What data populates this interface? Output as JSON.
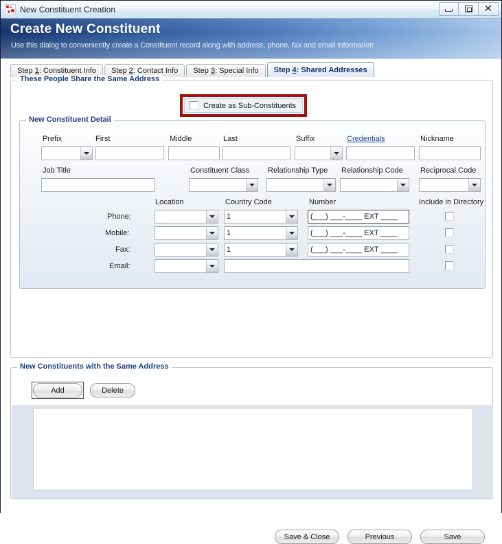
{
  "window": {
    "title": "New Constituent Creation",
    "icon": "constituent-icon",
    "controls": {
      "minimize": "minimize-icon",
      "restore": "restore-icon",
      "close": "close-icon",
      "close_glyph": "✕"
    }
  },
  "banner": {
    "title": "Create New Constituent",
    "subtitle": "Use this dialog to conveniently create a Constituent record along with address, phone, fax and email information"
  },
  "tabs": [
    {
      "prefix": "Step ",
      "key": "1",
      "suffix": ": Constituent Info",
      "active": false
    },
    {
      "prefix": "Step ",
      "key": "2",
      "suffix": ": Contact Info",
      "active": false
    },
    {
      "prefix": "Step ",
      "key": "3",
      "suffix": ": Special Info",
      "active": false
    },
    {
      "prefix": "Step ",
      "key": "4",
      "suffix": ": Shared Addresses",
      "active": true
    }
  ],
  "shared_address_group": {
    "legend": "These People Share the Same Address",
    "sub_constituents": {
      "label": "Create as Sub-Constituents",
      "checked": false,
      "highlight_color": "#a40f0f"
    }
  },
  "detail_group": {
    "legend": "New Constituent Detail",
    "name_row": {
      "prefix_label": "Prefix",
      "prefix_value": "",
      "first_label": "First",
      "first_value": "",
      "middle_label": "Middle",
      "middle_value": "",
      "last_label": "Last",
      "last_value": "",
      "suffix_label": "Suffix",
      "suffix_value": "",
      "credentials_label": "Credentials",
      "credentials_value": "",
      "nickname_label": "Nickname",
      "nickname_value": ""
    },
    "job_row": {
      "job_title_label": "Job Title",
      "job_title_value": "",
      "constituent_class_label": "Constituent Class",
      "constituent_class_value": "",
      "relationship_type_label": "Relationship Type",
      "relationship_type_value": "",
      "relationship_code_label": "Relationship Code",
      "relationship_code_value": "",
      "reciprocal_code_label": "Reciprocal Code",
      "reciprocal_code_value": ""
    },
    "contact_headers": {
      "location": "Location",
      "country_code": "Country Code",
      "number": "Number",
      "include_in_directory": "Include in Directory"
    },
    "contact_rows": [
      {
        "label": "Phone:",
        "location": "",
        "country_code": "1",
        "number": "(___) ___-____ EXT ____",
        "include_in_directory": false,
        "focused": true
      },
      {
        "label": "Mobile:",
        "location": "",
        "country_code": "1",
        "number": "(___) ___-____ EXT ____",
        "include_in_directory": false,
        "focused": false
      },
      {
        "label": "Fax:",
        "location": "",
        "country_code": "1",
        "number": "(___) ___-____ EXT ____",
        "include_in_directory": false,
        "focused": false
      },
      {
        "label": "Email:",
        "location": "",
        "country_code": null,
        "number": "",
        "include_in_directory": false,
        "focused": false
      }
    ]
  },
  "same_address_group": {
    "legend": "New Constituents with the Same Address",
    "add_button": "Add",
    "delete_button": "Delete",
    "list_items": []
  },
  "footer": {
    "save_close_button": "Save & Close",
    "previous_button": "Previous",
    "save_button": "Save"
  }
}
